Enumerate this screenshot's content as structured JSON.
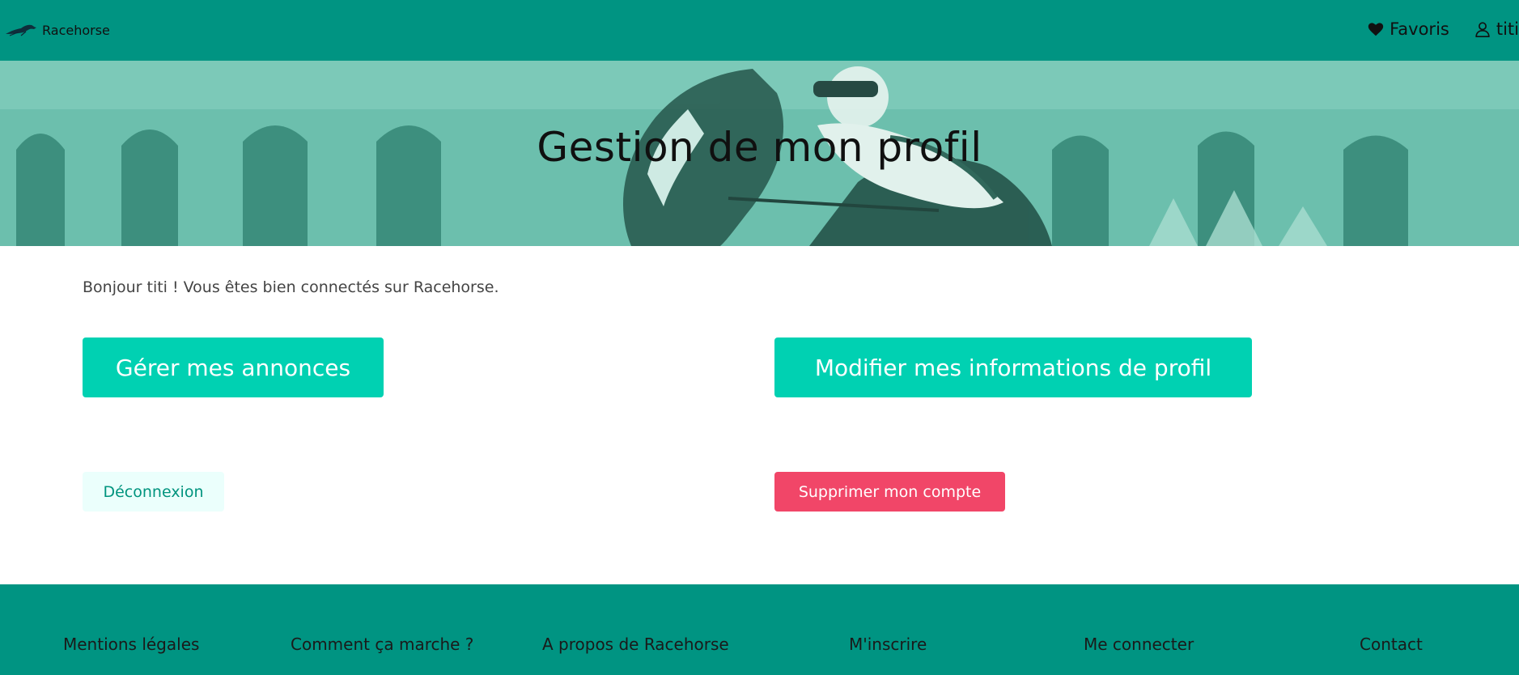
{
  "header": {
    "brand": "Racehorse",
    "favorites_label": "Favoris",
    "user_label": "titi",
    "colors": {
      "bar": "#009482"
    }
  },
  "hero": {
    "title": "Gestion de mon profil"
  },
  "main": {
    "greeting": "Bonjour titi ! Vous êtes bien connectés sur Racehorse.",
    "manage_ads_label": "Gérer mes annonces",
    "edit_profile_label": "Modifier mes informations de profil",
    "logout_label": "Déconnexion",
    "delete_account_label": "Supprimer mon compte",
    "colors": {
      "primary": "#00d1b2",
      "danger": "#f14668",
      "light": "#ebfffc"
    }
  },
  "footer": {
    "links": [
      "Mentions légales",
      "Comment ça marche ?",
      "A propos de Racehorse",
      "M'inscrire",
      "Me connecter",
      "Contact"
    ]
  }
}
